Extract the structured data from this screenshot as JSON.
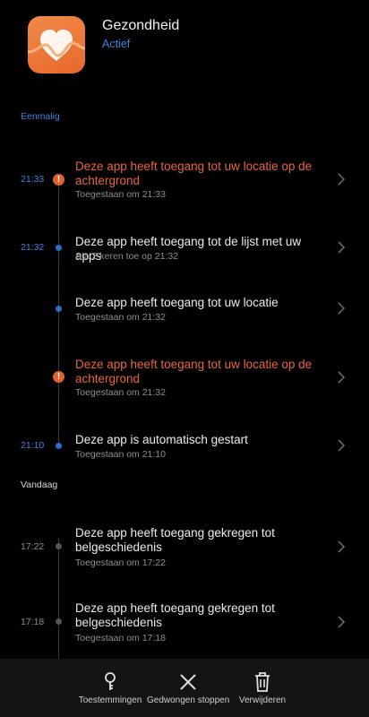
{
  "app": {
    "name": "Gezondheid",
    "status": "Actief"
  },
  "sections": {
    "once": "Eenmalig",
    "today": "Vandaag"
  },
  "entries": [
    {
      "time": "21:33",
      "title": "Deze app heeft toegang tot uw locatie op de achtergrond",
      "sub": "Toegestaan om 21:33",
      "warning": true
    },
    {
      "time": "21:32",
      "title": "Deze app heeft toegang tot de lijst met uw apps",
      "sub": "Sta 2 keren toe op 21:32",
      "warning": false
    },
    {
      "time": "",
      "title": "Deze app heeft toegang tot uw locatie",
      "sub": "Toegestaan om 21:32",
      "warning": false
    },
    {
      "time": "",
      "title": "Deze app heeft toegang tot uw locatie op de achtergrond",
      "sub": "Toegestaan om 21:32",
      "warning": true
    },
    {
      "time": "21:10",
      "title": "Deze app is automatisch gestart",
      "sub": "Toegestaan om 21:10",
      "warning": false
    },
    {
      "time": "17:22",
      "title": "Deze app heeft toegang gekregen tot belgeschiedenis",
      "sub": "Toegestaan om 17:22",
      "warning": false
    },
    {
      "time": "17:18",
      "title": "Deze app heeft toegang gekregen tot belgeschiedenis",
      "sub": "Toegestaan om 17:18",
      "warning": false
    }
  ],
  "bottom_bar": {
    "permissions": "Toestemmingen",
    "force_stop": "Gedwongen stoppen",
    "uninstall": "Verwijderen"
  },
  "colors": {
    "accent_blue": "#3d84e0",
    "warning_orange": "#e2622e",
    "background": "#000000"
  }
}
